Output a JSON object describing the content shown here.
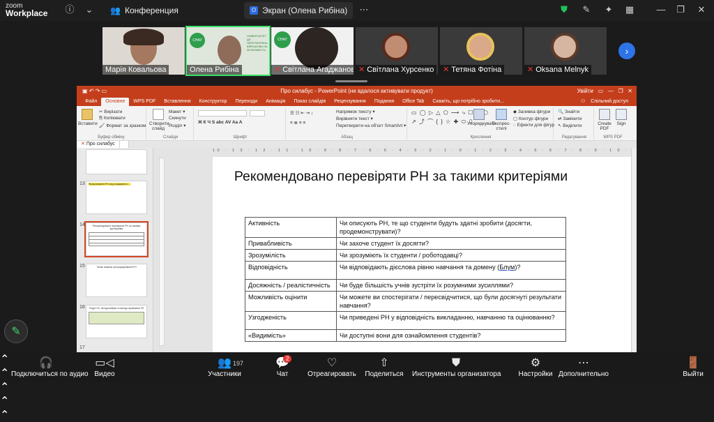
{
  "app": {
    "brand_small": "zoom",
    "brand_large": "Workplace"
  },
  "top_tabs": [
    {
      "label": "Конференция",
      "icon": "people-icon"
    },
    {
      "label": "Экран (Олена Рибіна)",
      "icon": "screen-share-icon"
    }
  ],
  "participants": [
    {
      "name": "Марія Ковальова",
      "muted": false
    },
    {
      "name": "Олена Рибіна",
      "muted": false
    },
    {
      "name": "Світлана Агаджанова",
      "muted": true
    },
    {
      "name": "Світлана Хурсенко",
      "muted": true
    },
    {
      "name": "Тетяна Фотіна",
      "muted": true
    },
    {
      "name": "Oksana Melnyk",
      "muted": true
    }
  ],
  "logo": {
    "text": "СНАУ",
    "caption": "УНІВЕРСИТЕТ ДО ПЕРЕТВОРЕНЬ ВІЙСЬКОВА НА МОЖЛИВІСТЬ"
  },
  "ppt": {
    "window_title": "Про силабус - PowerPoint (не вдалося активувати продукт)",
    "user": "Увійти",
    "share_label": "Спільний доступ",
    "tabs": [
      "Файл",
      "Основне",
      "WPS PDF",
      "Вставлення",
      "Конструктор",
      "Переходи",
      "Анімація",
      "Показ слайдів",
      "Рецензування",
      "Подання",
      "Office Tab",
      "Скажіть, що потрібно зробити..."
    ],
    "ribbon": {
      "paste": "Вставити",
      "cut": "Вирізати",
      "copy": "Копіювати",
      "format_painter": "Формат за зразком",
      "clipboard": "Буфер обміну",
      "new_slide": "Створити слайд",
      "layout": "Макет",
      "reset": "Скинути",
      "section": "Розділ",
      "slides": "Слайди",
      "font": "Шрифт",
      "text_direction": "Напрямок тексту",
      "align_text": "Вирівняти текст",
      "convert_smartart": "Перетворити на об'єкт SmartArt",
      "paragraph": "Абзац",
      "drawing": "Креслення",
      "arrange": "Упорядкувати",
      "quick_styles": "Експрес-стилі",
      "shape_fill": "Заливка фігури",
      "shape_outline": "Контур фігури",
      "shape_effects": "Ефекти для фігур",
      "find": "Знайти",
      "replace": "Замінити",
      "select": "Виділити",
      "editing": "Редагування",
      "create_pdf": "Create PDF",
      "sign": "Sign",
      "wps_pdf": "WPS PDF"
    },
    "doc_tab": "Про силабус",
    "ruler_text": "10 · 1 3 · 1 2 · 1 1 · 1 0 · 9 · 8 · 7 · 6 · 5 · 4 · 3 · 2 · 1 · 0 · 1 · 2 · 3 · 4 · 5 · 6 · 7 · 8 · 9 · 1 0 · 1 1 · 1 2 · 1 3",
    "thumbnails": [
      {
        "num": "",
        "text": ""
      },
      {
        "num": "13",
        "text": "Формулювання РН слід узгоджувати з ..."
      },
      {
        "num": "14",
        "text": "Рекомендовано перевіряти РН за такими критеріями"
      },
      {
        "num": "15",
        "text": "Типові помилки при формулюванні РН"
      },
      {
        "num": "16",
        "text": "Розділ ОС: методи вибірки та методи оцінювання РН"
      },
      {
        "num": "17",
        "text": ""
      }
    ],
    "slide": {
      "title": "Рекомендовано перевіряти РН за такими критеріями",
      "rows": [
        {
          "criterion": "Активність",
          "question": "Чи описують РН, те що студенти будуть здатні зробити (досягти, продемонструвати)?"
        },
        {
          "criterion": "Привабливість",
          "question": "Чи захоче студент їх досягти?"
        },
        {
          "criterion": "Зрозумілість",
          "question": "Чи зрозуміють їх студенти / роботодавці?"
        },
        {
          "criterion": "Відповідність",
          "question_pre": "Чи відповідають дієслова рівню навчання та домену (",
          "question_u": "Блум",
          "question_post": ")?"
        },
        {
          "criterion": "Досяжність / реалістичність",
          "question": "Чи буде більшість учнів зустріти їх розумними зусиллями?"
        },
        {
          "criterion": "Можливість оцінити",
          "question": "Чи можете ви спостерігати / пересвідчитися, що були досягнуті результати навчання?"
        },
        {
          "criterion": "Узгодженість",
          "question": "Чи приведені РН у відповідність викладанню, навчанню та оцінюванню?"
        },
        {
          "criterion": "«Видимість»",
          "question": "Чи доступні вони для ознайомлення студентів?"
        }
      ]
    }
  },
  "toolbar": {
    "audio": "Подключиться по аудио",
    "video": "Видео",
    "participants": "Участники",
    "participants_count": "197",
    "chat": "Чат",
    "chat_badge": "2",
    "react": "Отреагировать",
    "share": "Поделиться",
    "host_tools": "Инструменты организатора",
    "settings": "Настройки",
    "more": "Дополнительно",
    "leave": "Выйти"
  },
  "colors": {
    "ppt_accent": "#c43e1c",
    "active_speaker": "#3be06a",
    "mute": "#e53935",
    "nav_button": "#2e73e8"
  }
}
